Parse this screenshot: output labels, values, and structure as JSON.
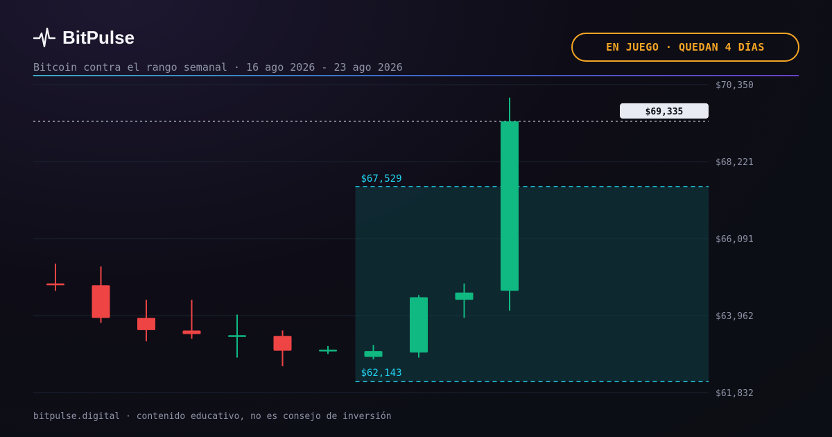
{
  "header": {
    "brand": "BitPulse",
    "subtitle": "Bitcoin contra el rango semanal · 16 ago 2026 - 23 ago 2026",
    "status": "EN JUEGO · QUEDAN 4 DÍAS"
  },
  "footer": "bitpulse.digital · contenido educativo, no es consejo de inversión",
  "colors": {
    "up": "#10b981",
    "down": "#ef4444",
    "range": "#22d3ee",
    "accent": "#f5a524"
  },
  "icons": {
    "brand_icon": "pulse-icon"
  },
  "chart_data": {
    "type": "candlestick",
    "ylim": [
      61832,
      70350
    ],
    "y_ticks": [
      "$70,350",
      "$68,221",
      "$66,091",
      "$63,962",
      "$61,832"
    ],
    "grid": true,
    "range": {
      "high": 67529,
      "low": 62143,
      "high_label": "$67,529",
      "low_label": "$62,143",
      "start_candle": 7
    },
    "current_price": {
      "value": 69335,
      "label": "$69,335"
    },
    "candles": [
      {
        "open": 64850,
        "high": 65400,
        "low": 64650,
        "close": 64800
      },
      {
        "open": 64800,
        "high": 65320,
        "low": 63760,
        "close": 63900
      },
      {
        "open": 63900,
        "high": 64400,
        "low": 63250,
        "close": 63560
      },
      {
        "open": 63550,
        "high": 64400,
        "low": 63320,
        "close": 63450
      },
      {
        "open": 63420,
        "high": 63990,
        "low": 62800,
        "close": 63420
      },
      {
        "open": 63400,
        "high": 63550,
        "low": 62560,
        "close": 62990
      },
      {
        "open": 63000,
        "high": 63120,
        "low": 62900,
        "close": 63020
      },
      {
        "open": 62820,
        "high": 63150,
        "low": 62750,
        "close": 62980
      },
      {
        "open": 62940,
        "high": 64530,
        "low": 62800,
        "close": 64470
      },
      {
        "open": 64400,
        "high": 64850,
        "low": 63900,
        "close": 64600
      },
      {
        "open": 64650,
        "high": 69990,
        "low": 64100,
        "close": 69335
      }
    ]
  }
}
